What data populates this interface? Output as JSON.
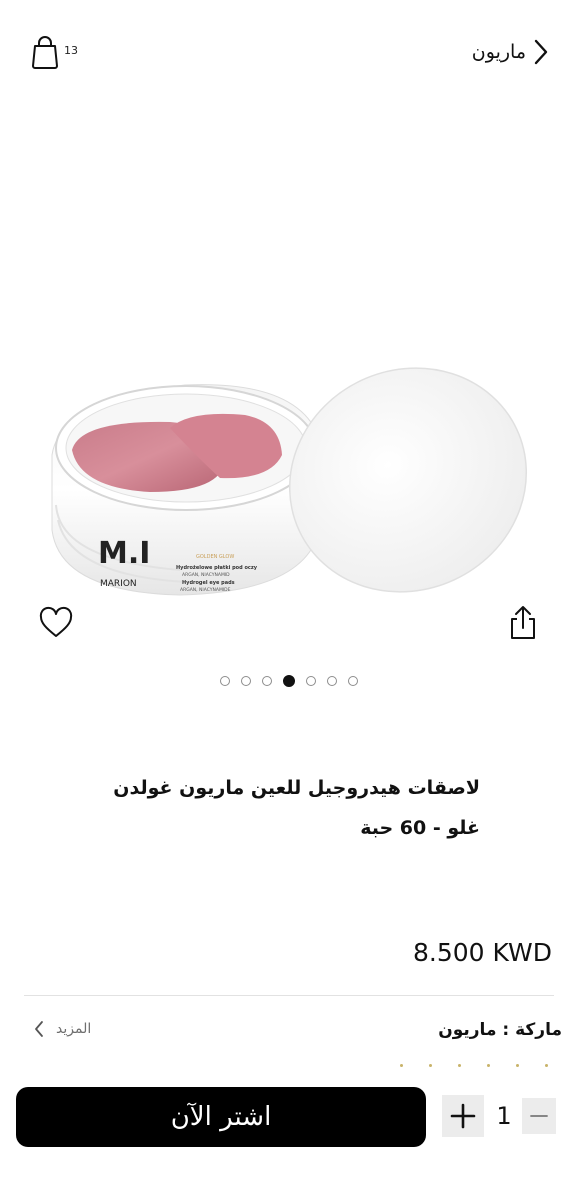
{
  "header": {
    "back_label": "ماريون",
    "cart_count": "13"
  },
  "product": {
    "image_label": {
      "brand_mark": "M.I",
      "brand_name": "MARION",
      "line_name": "GOLDEN GLOW",
      "desc_pl": "Hydrożelowe płatki pod oczy",
      "desc_pl_sub": "ARGAN, NIACYNAMID",
      "desc_en": "Hydrogel eye pads",
      "desc_en_sub": "ARGAN, NIACYNAMIDE"
    },
    "title_line1": "لاصقات هيدروجيل للعين ماريون غولدن",
    "title_line2": "غلو - 60 حبة",
    "price": "8.500 KWD",
    "brand_label": "ماركة :",
    "brand_value": "ماريون",
    "more_label": "المزيد",
    "image_count": 7,
    "active_image_index": 3
  },
  "purchase": {
    "buy_label": "اشتر الآن",
    "quantity": "1"
  },
  "icons": {
    "bag": "shopping-bag-icon",
    "back": "chevron-right-icon",
    "heart": "heart-icon",
    "share": "share-icon",
    "more": "chevron-left-icon",
    "plus": "plus-icon",
    "minus": "minus-icon"
  }
}
